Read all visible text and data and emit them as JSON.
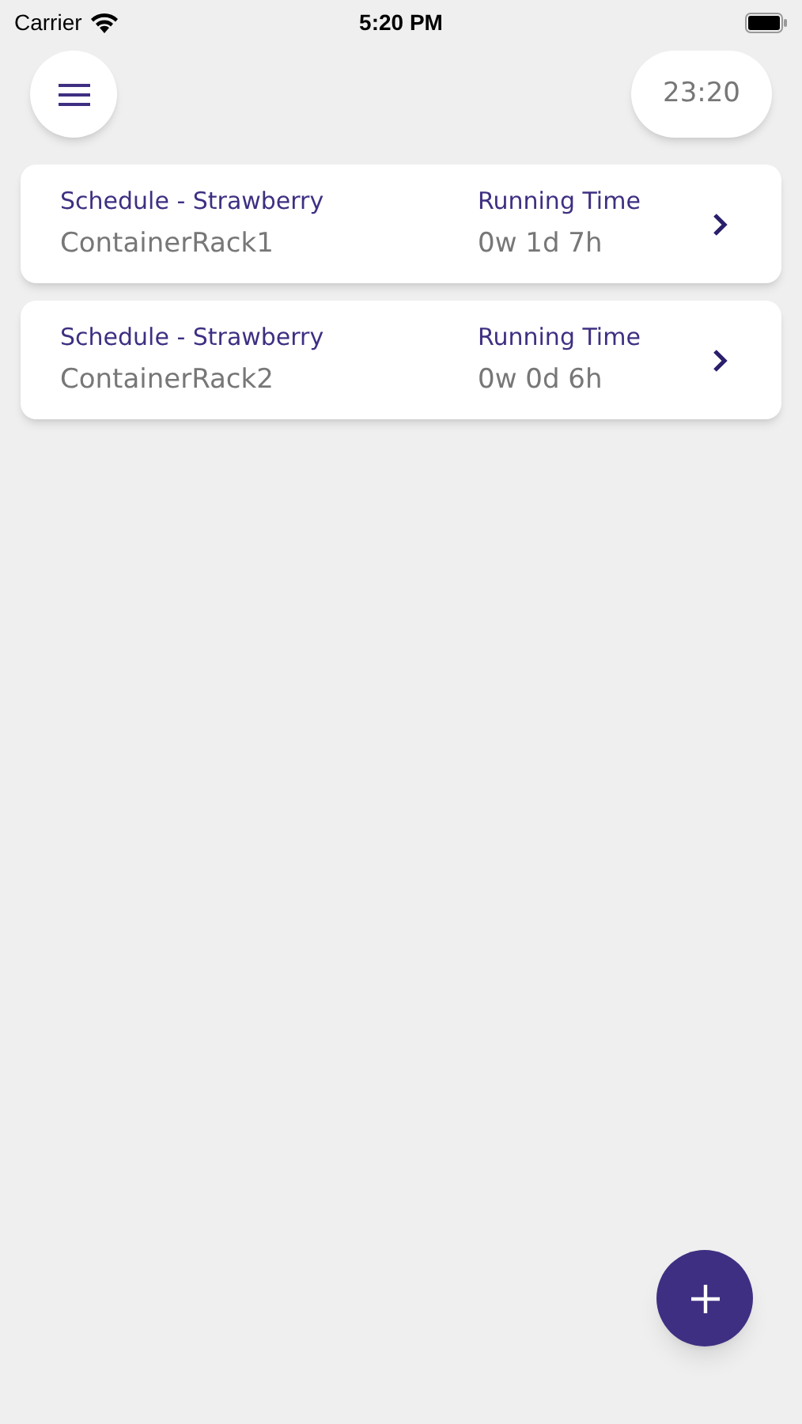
{
  "status_bar": {
    "carrier": "Carrier",
    "time": "5:20 PM"
  },
  "header": {
    "clock": "23:20"
  },
  "racks": [
    {
      "schedule": "Schedule - Strawberry",
      "name": "ContainerRack1",
      "running_label": "Running Time",
      "running_time": "0w 1d 7h"
    },
    {
      "schedule": "Schedule - Strawberry",
      "name": "ContainerRack2",
      "running_label": "Running Time",
      "running_time": "0w 0d 6h"
    }
  ]
}
